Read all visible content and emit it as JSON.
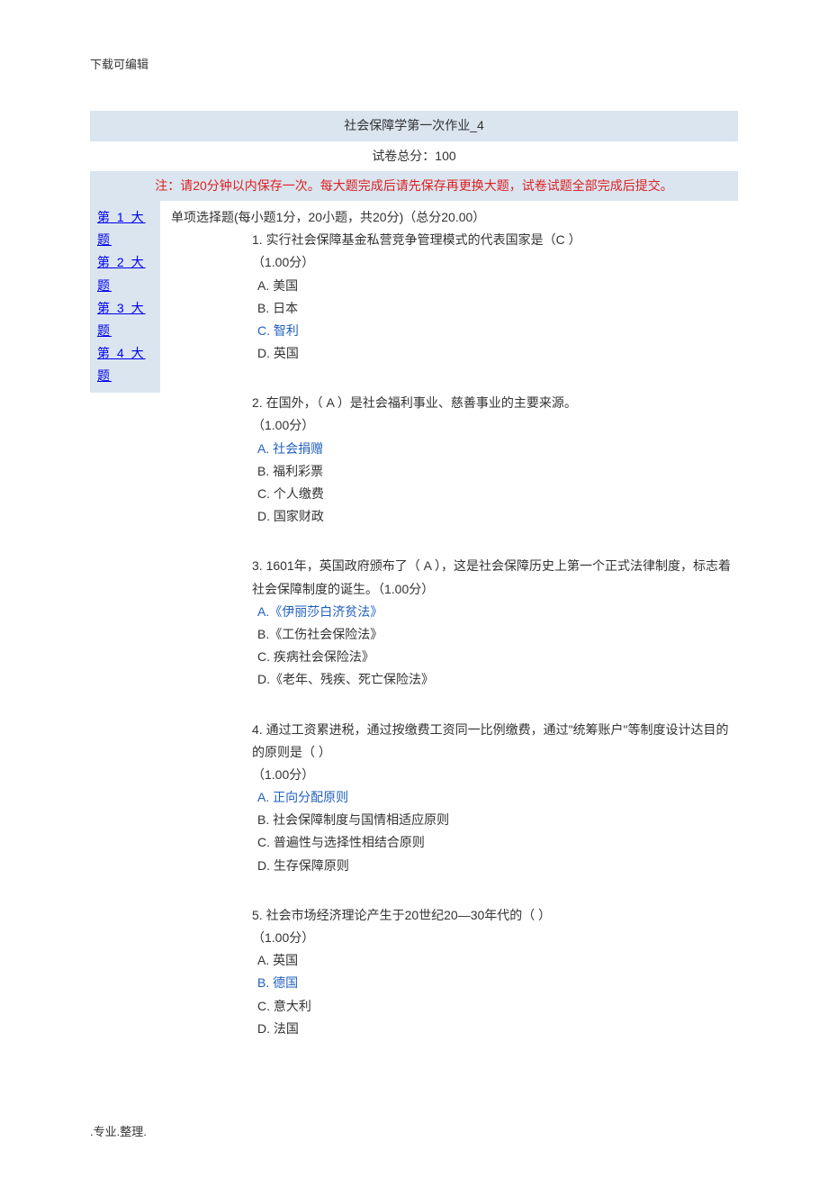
{
  "header": "下载可编辑",
  "title": "社会保障学第一次作业_4",
  "total_score_label": "试卷总分：100",
  "notice": "注：请20分钟以内保存一次。每大题完成后请先保存再更换大题，试卷试题全部完成后提交。",
  "sidebar": {
    "links": [
      "第 1 大题",
      "第 2 大题",
      "第 3 大题",
      "第 4 大题"
    ]
  },
  "section_title": "单项选择题(每小题1分，20小题，共20分)（总分20.00）",
  "questions": [
    {
      "text": "1. 实行社会保障基金私营竞争管理模式的代表国家是（C ）",
      "text2": "",
      "text3": "",
      "score": "（1.00分）",
      "options": {
        "a": "A. 美国",
        "b": "B. 日本",
        "c": "C. 智利",
        "d": "D. 英国"
      },
      "correct_idx": "c"
    },
    {
      "text": "2. 在国外，（ A   ）是社会福利事业、慈善事业的主要来源。",
      "text2": "",
      "text3": "",
      "score": "（1.00分）",
      "options": {
        "a": "A. 社会捐赠",
        "b": "B. 福利彩票",
        "c": "C. 个人缴费",
        "d": "D. 国家财政"
      },
      "correct_idx": "a"
    },
    {
      "text": "3. 1601年，英国政府颁布了（  A  ），这是社会保障历史上第一个正式法律制度，标志着",
      "text2": "",
      "text3": "",
      "score": "社会保障制度的诞生。（1.00分）",
      "options": {
        "a": "A.《伊丽莎白济贫法》",
        "b": "B.《工伤社会保险法》",
        "c": "C. 疾病社会保险法》",
        "d": "D.《老年、残疾、死亡保险法》"
      },
      "correct_idx": "a"
    },
    {
      "text": "4. 通过工资累进税，通过按缴费工资同一比例缴费，通过\"统筹账户\"等制度设计达目的的原则是（    ）",
      "text2": "",
      "text3": "",
      "score": "（1.00分）",
      "options": {
        "a": "A. 正向分配原则",
        "b": "B. 社会保障制度与国情相适应原则",
        "c": "C. 普遍性与选择性相结合原则",
        "d": "D. 生存保障原则"
      },
      "correct_idx": "a"
    },
    {
      "text": "5. 社会市场经济理论产生于20世纪20—30年代的（     ）",
      "text2": "",
      "text3": "",
      "score": "（1.00分）",
      "options": {
        "a": "A. 英国",
        "b": "B. 德国",
        "c": "C. 意大利",
        "d": "D. 法国"
      },
      "correct_idx": "b"
    }
  ],
  "footer": ".专业.整理."
}
